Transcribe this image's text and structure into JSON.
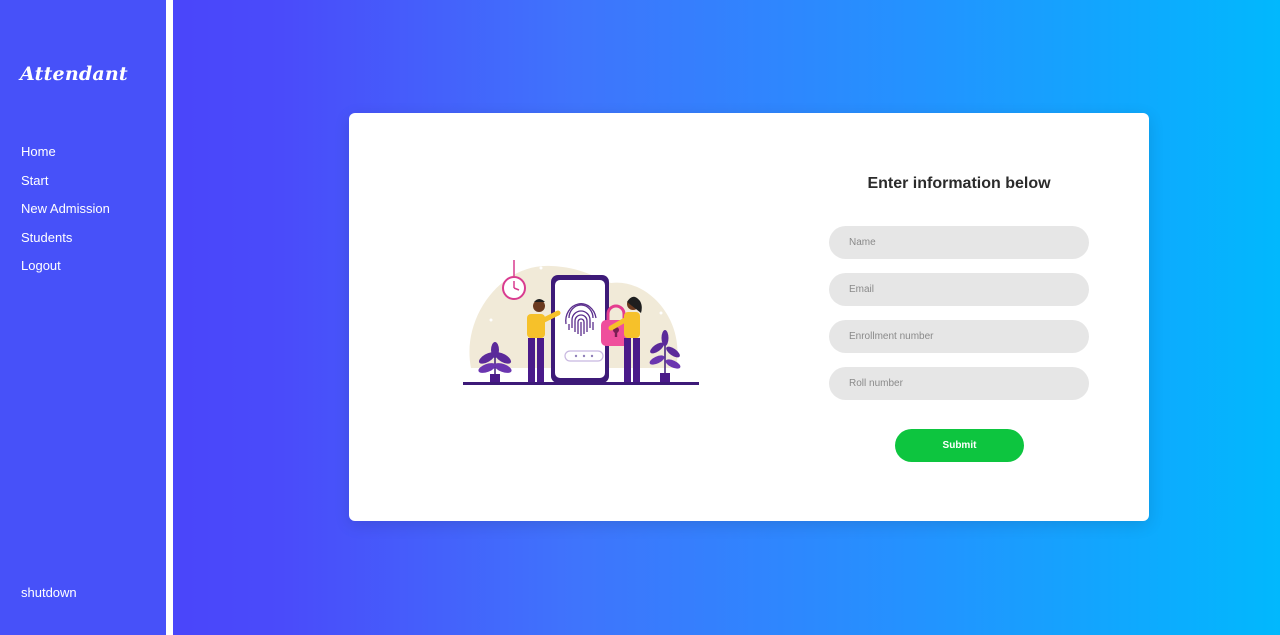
{
  "sidebar": {
    "brand": "Attendant",
    "nav": [
      "Home",
      "Start",
      "New Admission",
      "Students",
      "Logout"
    ],
    "shutdown": "shutdown"
  },
  "form": {
    "title": "Enter information below",
    "fields": {
      "name": {
        "placeholder": "Name",
        "value": ""
      },
      "email": {
        "placeholder": "Email",
        "value": ""
      },
      "enrollment": {
        "placeholder": "Enrollment number",
        "value": ""
      },
      "roll": {
        "placeholder": "Roll number",
        "value": ""
      }
    },
    "submit_label": "Submit"
  },
  "illustration": {
    "icon": "fingerprint-security-illustration"
  },
  "colors": {
    "sidebar": "#4751f9",
    "gradient_start": "#4a3dfb",
    "gradient_end": "#01b8fd",
    "submit": "#0dc53f",
    "field_bg": "#e6e6e6"
  }
}
